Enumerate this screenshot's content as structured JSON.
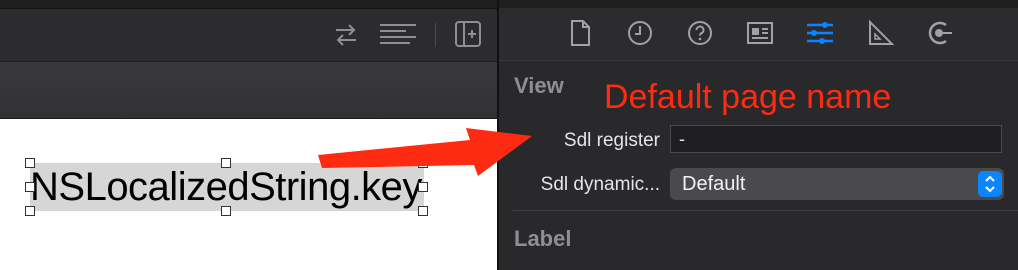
{
  "canvas": {
    "label_text": "NSLocalizedString.key"
  },
  "left_toolbar": {
    "icons": [
      "swap-arrows-icon",
      "lines-align-icon",
      "add-editor-icon"
    ]
  },
  "inspector": {
    "tabs": [
      "file-icon",
      "history-icon",
      "help-icon",
      "identity-icon",
      "attributes-icon",
      "size-icon",
      "connections-icon"
    ],
    "selected_tab": "attributes-icon",
    "accent_color": "#0a84ff",
    "section_view": "View",
    "sdl_register_label": "Sdl register",
    "sdl_register_value": "-",
    "sdl_dynamic_label": "Sdl dynamic...",
    "sdl_dynamic_value": "Default",
    "section_label": "Label"
  },
  "annotation": {
    "text": "Default page name",
    "color": "#ff2a12"
  }
}
